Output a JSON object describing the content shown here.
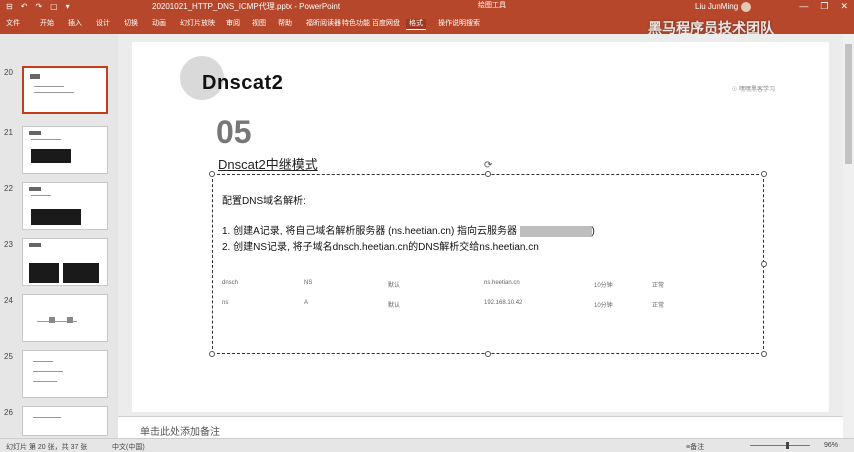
{
  "window": {
    "quick_access": [
      "⊟",
      "↶",
      "↷",
      "▢",
      "▾"
    ],
    "doc_title": "20201021_HTTP_DNS_ICMP代理.pptx  -  PowerPoint",
    "tools_context": "绘图工具",
    "user": "Liu JunMing",
    "controls": [
      "—",
      "❐",
      "✕"
    ]
  },
  "ribbon": {
    "tabs": [
      "文件",
      "开始",
      "插入",
      "设计",
      "切换",
      "动画",
      "幻灯片放映",
      "审阅",
      "视图",
      "帮助",
      "福昕阅读器",
      "特色功能",
      "百度网盘",
      "格式",
      "操作说明搜索"
    ],
    "active_index": 13
  },
  "thumbnails": [
    {
      "num": "20",
      "selected": true
    },
    {
      "num": "21",
      "selected": false
    },
    {
      "num": "22",
      "selected": false
    },
    {
      "num": "23",
      "selected": false
    },
    {
      "num": "24",
      "selected": false
    },
    {
      "num": "25",
      "selected": false
    },
    {
      "num": "26",
      "selected": false
    }
  ],
  "slide": {
    "title": "Dnscat2",
    "badge": "☉ 嘿嘿黑客学习",
    "section_number": "05",
    "section_subtitle": "Dnscat2中继模式",
    "intro": "配置DNS域名解析:",
    "line1_prefix": "1.  创建A记录, 将自己域名解析服务器 (ns.heetian.cn) 指向云服务器",
    "line1_suffix": ")",
    "line2": "2.  创建NS记录, 将子域名dnsch.heetian.cn的DNS解析交给ns.heetian.cn",
    "table_rows": [
      [
        "dnsch",
        "NS",
        "默认",
        "ns.heetian.cn",
        "10分钟",
        "正常"
      ],
      [
        "ns",
        "A",
        "默认",
        "192.168.10.42",
        "10分钟",
        "正常"
      ]
    ]
  },
  "notes_placeholder": "单击此处添加备注",
  "status": {
    "slide_info": "幻灯片 第 20 张，共 37 张",
    "language": "中文(中国)",
    "notes_btn": "≡备注",
    "zoom": "96%"
  },
  "watermark": "黑马程序员技术团队"
}
